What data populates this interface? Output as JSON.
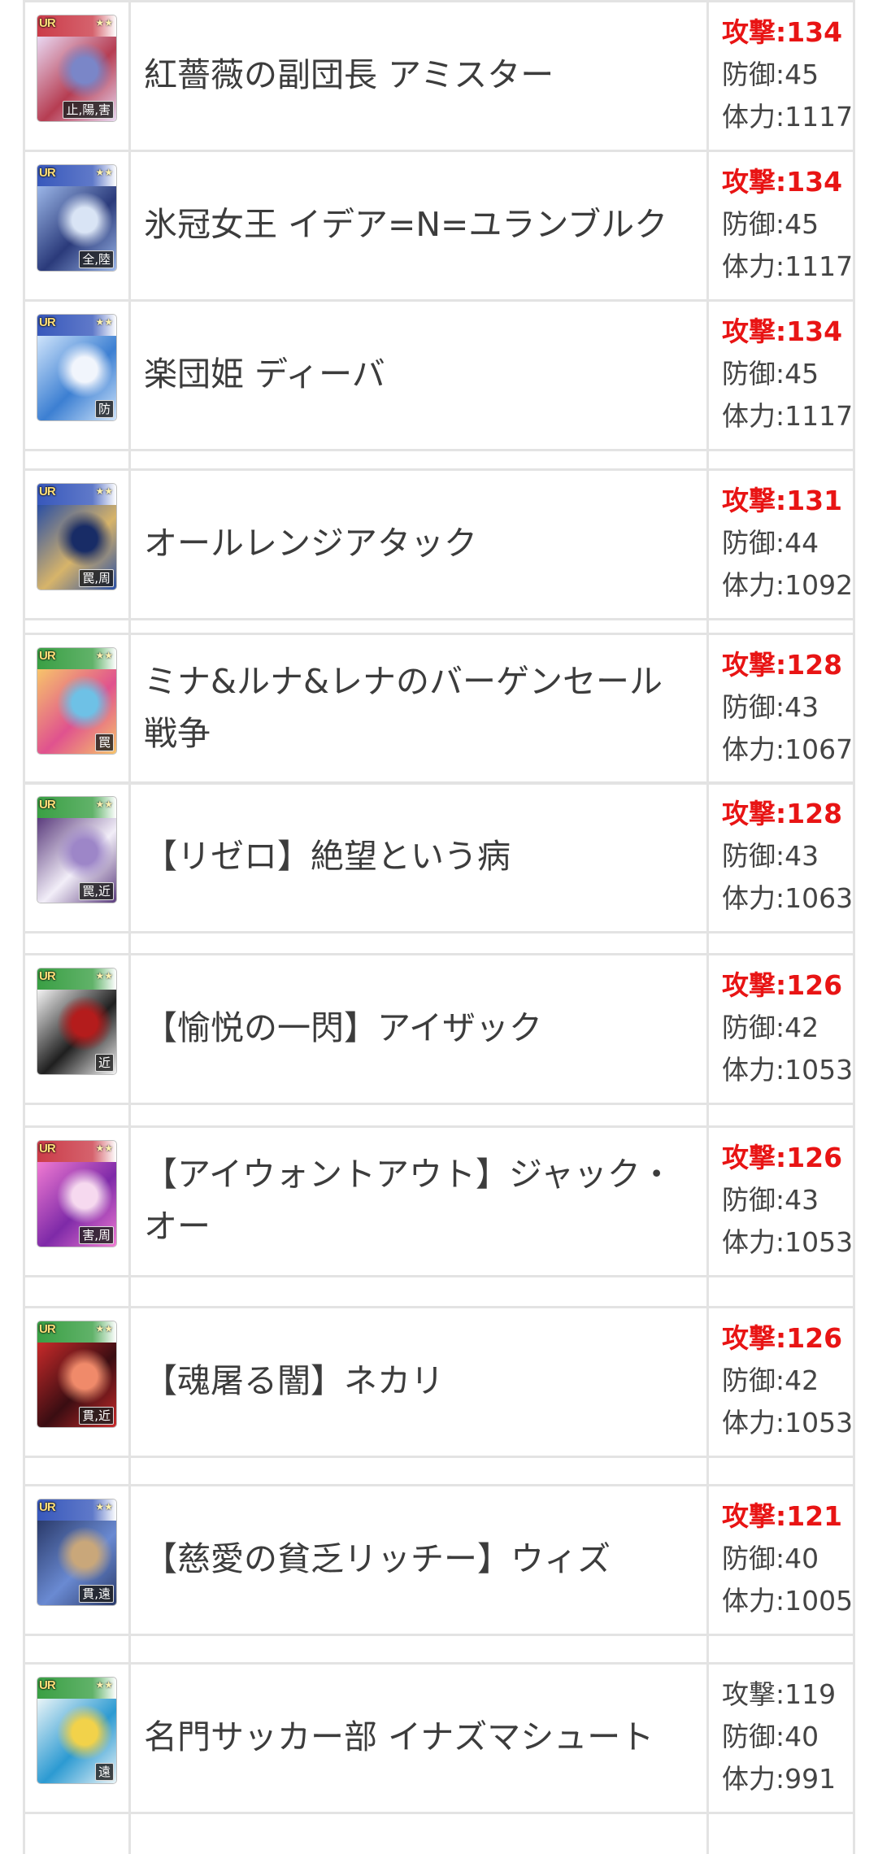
{
  "rows": [
    {
      "name": "紅薔薇の副団長 アミスター",
      "type": "止,陽,害",
      "attack_label": "攻撃:134",
      "defense_label": "防御:45",
      "hp_label": "体力:1117",
      "highlight": true,
      "band": "#c8313f",
      "art": [
        "#e9d8f2",
        "#b63d52",
        "#7a86c8"
      ]
    },
    {
      "name": "氷冠女王 イデア=N=ユランブルク",
      "type": "全,陸",
      "attack_label": "攻撃:134",
      "defense_label": "防御:45",
      "hp_label": "体力:1117",
      "highlight": true,
      "band": "#2d4fb8",
      "art": [
        "#9bb6e8",
        "#2a3a7a",
        "#d9e4f5"
      ]
    },
    {
      "name": "楽団姫 ディーバ",
      "type": "防",
      "attack_label": "攻撃:134",
      "defense_label": "防御:45",
      "hp_label": "体力:1117",
      "highlight": true,
      "band": "#2d4fb8",
      "art": [
        "#cfe4fb",
        "#3c7fd2",
        "#f1f5fc"
      ]
    },
    {
      "name": "オールレンジアタック",
      "type": "罠,周",
      "attack_label": "攻撃:131",
      "defense_label": "防御:44",
      "hp_label": "体力:1092",
      "highlight": true,
      "band": "#2d4fb8",
      "art": [
        "#2a4fa4",
        "#d7b46a",
        "#182c66"
      ]
    },
    {
      "name": "ミナ&ルナ&レナのバーゲンセール戦争",
      "type": "罠",
      "attack_label": "攻撃:128",
      "defense_label": "防御:43",
      "hp_label": "体力:1067",
      "highlight": true,
      "band": "#2f9a3a",
      "art": [
        "#f7c46a",
        "#e0528e",
        "#6ec1e6"
      ]
    },
    {
      "name": "【リゼロ】絶望という病",
      "type": "罠,近",
      "attack_label": "攻撃:128",
      "defense_label": "防御:43",
      "hp_label": "体力:1063",
      "highlight": true,
      "band": "#2f9a3a",
      "art": [
        "#5b3c7d",
        "#f2eef8",
        "#9d86c8"
      ]
    },
    {
      "name": "【愉悦の一閃】アイザック",
      "type": "近",
      "attack_label": "攻撃:126",
      "defense_label": "防御:42",
      "hp_label": "体力:1053",
      "highlight": true,
      "band": "#2f9a3a",
      "art": [
        "#f4f4f4",
        "#1f1f1f",
        "#b41c1c"
      ]
    },
    {
      "name": "【アイウォントアウト】ジャック・オー",
      "type": "害,周",
      "attack_label": "攻撃:126",
      "defense_label": "防御:43",
      "hp_label": "体力:1053",
      "highlight": true,
      "band": "#c8313f",
      "art": [
        "#f07ad2",
        "#7e2aa8",
        "#f6d9ef"
      ]
    },
    {
      "name": "【魂屠る闇】ネカリ",
      "type": "貫,近",
      "attack_label": "攻撃:126",
      "defense_label": "防御:42",
      "hp_label": "体力:1053",
      "highlight": true,
      "band": "#2f9a3a",
      "art": [
        "#c82a2a",
        "#3a0d12",
        "#f08a6a"
      ]
    },
    {
      "name": "【慈愛の貧乏リッチー】ウィズ",
      "type": "貫,遠",
      "attack_label": "攻撃:121",
      "defense_label": "防御:40",
      "hp_label": "体力:1005",
      "highlight": true,
      "band": "#2d4fb8",
      "art": [
        "#2a3a6a",
        "#6a8ad2",
        "#c9a77a"
      ]
    },
    {
      "name": "名門サッカー部 イナズマシュート",
      "type": "遠",
      "attack_label": "攻撃:119",
      "defense_label": "防御:40",
      "hp_label": "体力:991",
      "highlight": false,
      "band": "#2f9a3a",
      "art": [
        "#e9f4f7",
        "#2c9ad2",
        "#f2d24a"
      ]
    }
  ],
  "badge_label": "UR",
  "stars": "★★"
}
